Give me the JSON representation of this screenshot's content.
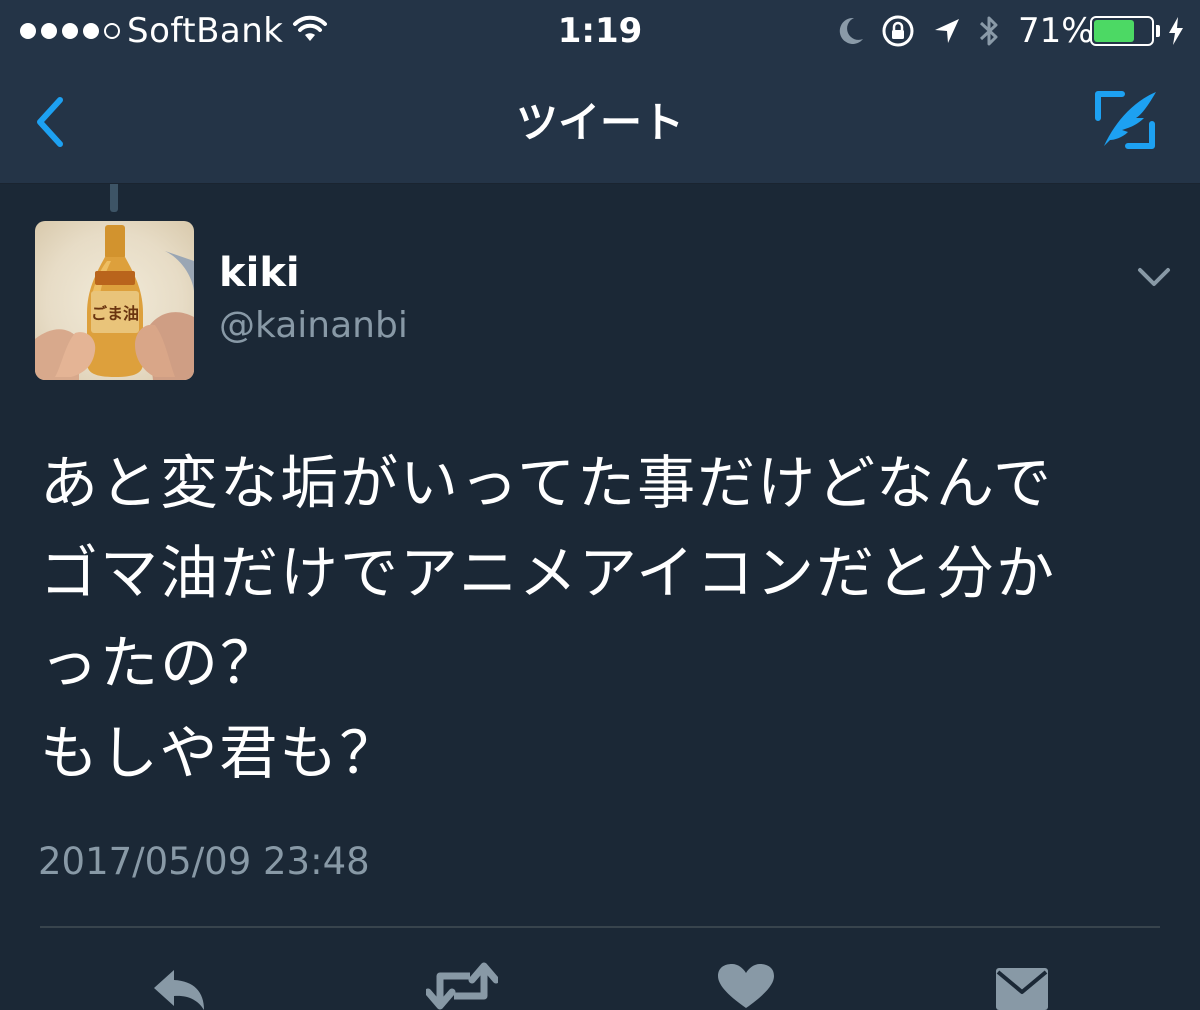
{
  "status_bar": {
    "carrier": "SoftBank",
    "time": "1:19",
    "battery_percent_text": "71%",
    "battery_level": 0.71,
    "battery_color": "#4cd964"
  },
  "nav": {
    "title": "ツイート",
    "back_icon": "chevron-left-icon",
    "compose_icon": "compose-quill-icon",
    "accent_color": "#1da1f2"
  },
  "tweet": {
    "author_name": "kiki",
    "author_handle": "@kainanbi",
    "text_lines": [
      "あと変な垢がいってた事だけどなんで",
      "ゴマ油だけでアニメアイコンだと分か",
      "ったの？",
      "もしや君も？"
    ],
    "timestamp": "2017/05/09 23:48",
    "avatar_label": "ごま油"
  },
  "actions": [
    {
      "name": "reply",
      "icon": "reply-icon"
    },
    {
      "name": "retweet",
      "icon": "retweet-icon"
    },
    {
      "name": "like",
      "icon": "heart-icon"
    },
    {
      "name": "direct-message",
      "icon": "envelope-icon"
    }
  ],
  "colors": {
    "background": "#1b2836",
    "bar_background": "#243447",
    "secondary_text": "#8899a6"
  }
}
